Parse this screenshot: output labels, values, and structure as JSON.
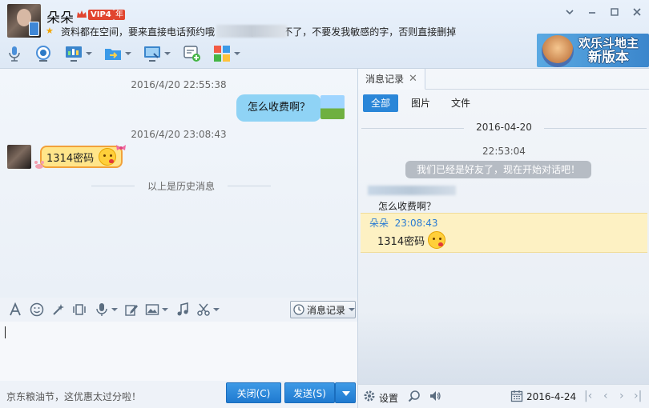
{
  "header": {
    "contact_name": "朵朵",
    "vip_label": "VIP4",
    "year_label": "年",
    "signature": "资料都在空间，要来直接电话预约哦                   朵朵，Q经常上不了，不要发我敏感的字，否则直接删掉"
  },
  "toolbar_icons": [
    "microphone-icon",
    "video-call-icon",
    "screen-share-icon",
    "file-transfer-icon",
    "remote-desktop-icon",
    "create-group-icon",
    "apps-icon"
  ],
  "ad": {
    "line1": "欢乐斗地主",
    "line2": "新版本"
  },
  "chat": {
    "messages": [
      {
        "time": "2016/4/20 22:55:38",
        "text": "怎么收费啊？",
        "direction": "out"
      },
      {
        "time": "2016/4/20 23:08:43",
        "text": "1314密码",
        "direction": "in"
      }
    ],
    "history_divider": "以上是历史消息"
  },
  "input_toolbar": {
    "history_button": "消息记录"
  },
  "footer": {
    "promo": "京东粮油节，这优惠太过分啦！",
    "close_button": "关闭(C)",
    "send_button": "发送(S)"
  },
  "history_panel": {
    "tab_label": "消息记录",
    "filters": [
      "全部",
      "图片",
      "文件"
    ],
    "date": "2016-04-20",
    "time": "22:53:04",
    "system_note": "我们已经是好友了，现在开始对话吧！",
    "entry1_text": "怎么收费啊？",
    "entry2_sender": "朵朵",
    "entry2_time": "23:08:43",
    "entry2_text": "1314密码",
    "settings_label": "设置",
    "current_date": "2016-4-24"
  },
  "colors": {
    "accent": "#2a86d8",
    "bubble_out": "#8fd3f5",
    "bubble_in": "#ffe58a",
    "highlight": "#fdf1c3"
  }
}
